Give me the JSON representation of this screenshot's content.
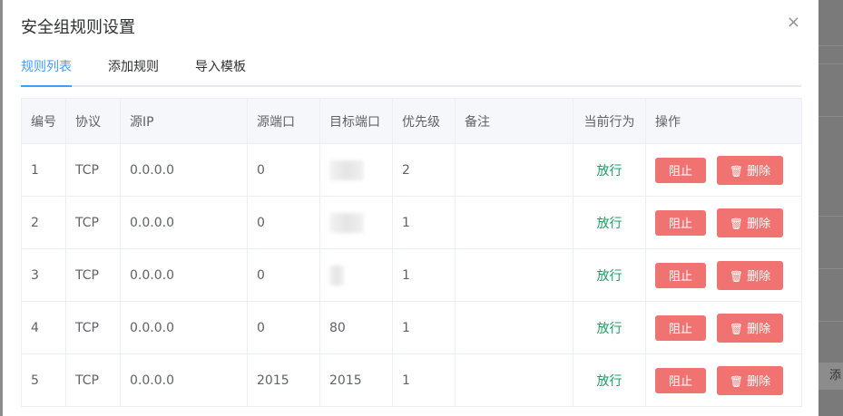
{
  "dialog": {
    "title": "安全组规则设置",
    "close_icon": "×"
  },
  "tabs": [
    {
      "label": "规则列表",
      "active": true
    },
    {
      "label": "添加规则",
      "active": false
    },
    {
      "label": "导入模板",
      "active": false
    }
  ],
  "table": {
    "headers": [
      "编号",
      "协议",
      "源IP",
      "源端口",
      "目标端口",
      "优先级",
      "备注",
      "当前行为",
      "操作"
    ],
    "rows": [
      {
        "id": "1",
        "protocol": "TCP",
        "src_ip": "0.0.0.0",
        "src_port": "0",
        "dst_port": "",
        "dst_port_redacted": true,
        "priority": "2",
        "note": "",
        "status": "放行"
      },
      {
        "id": "2",
        "protocol": "TCP",
        "src_ip": "0.0.0.0",
        "src_port": "0",
        "dst_port": "",
        "dst_port_redacted": true,
        "priority": "1",
        "note": "",
        "status": "放行"
      },
      {
        "id": "3",
        "protocol": "TCP",
        "src_ip": "0.0.0.0",
        "src_port": "0",
        "dst_port": "",
        "dst_port_redacted": true,
        "priority": "1",
        "note": "",
        "status": "放行"
      },
      {
        "id": "4",
        "protocol": "TCP",
        "src_ip": "0.0.0.0",
        "src_port": "0",
        "dst_port": "80",
        "dst_port_redacted": false,
        "priority": "1",
        "note": "",
        "status": "放行"
      },
      {
        "id": "5",
        "protocol": "TCP",
        "src_ip": "0.0.0.0",
        "src_port": "2015",
        "dst_port": "2015",
        "dst_port_redacted": false,
        "priority": "1",
        "note": "",
        "status": "放行"
      }
    ],
    "block_label": "阻止",
    "delete_label": "删除",
    "delete_icon": "trash-icon"
  },
  "background": {
    "add_label": "添"
  },
  "colors": {
    "accent": "#409eff",
    "status_allow": "#13a35f",
    "danger_button": "#f07371"
  }
}
